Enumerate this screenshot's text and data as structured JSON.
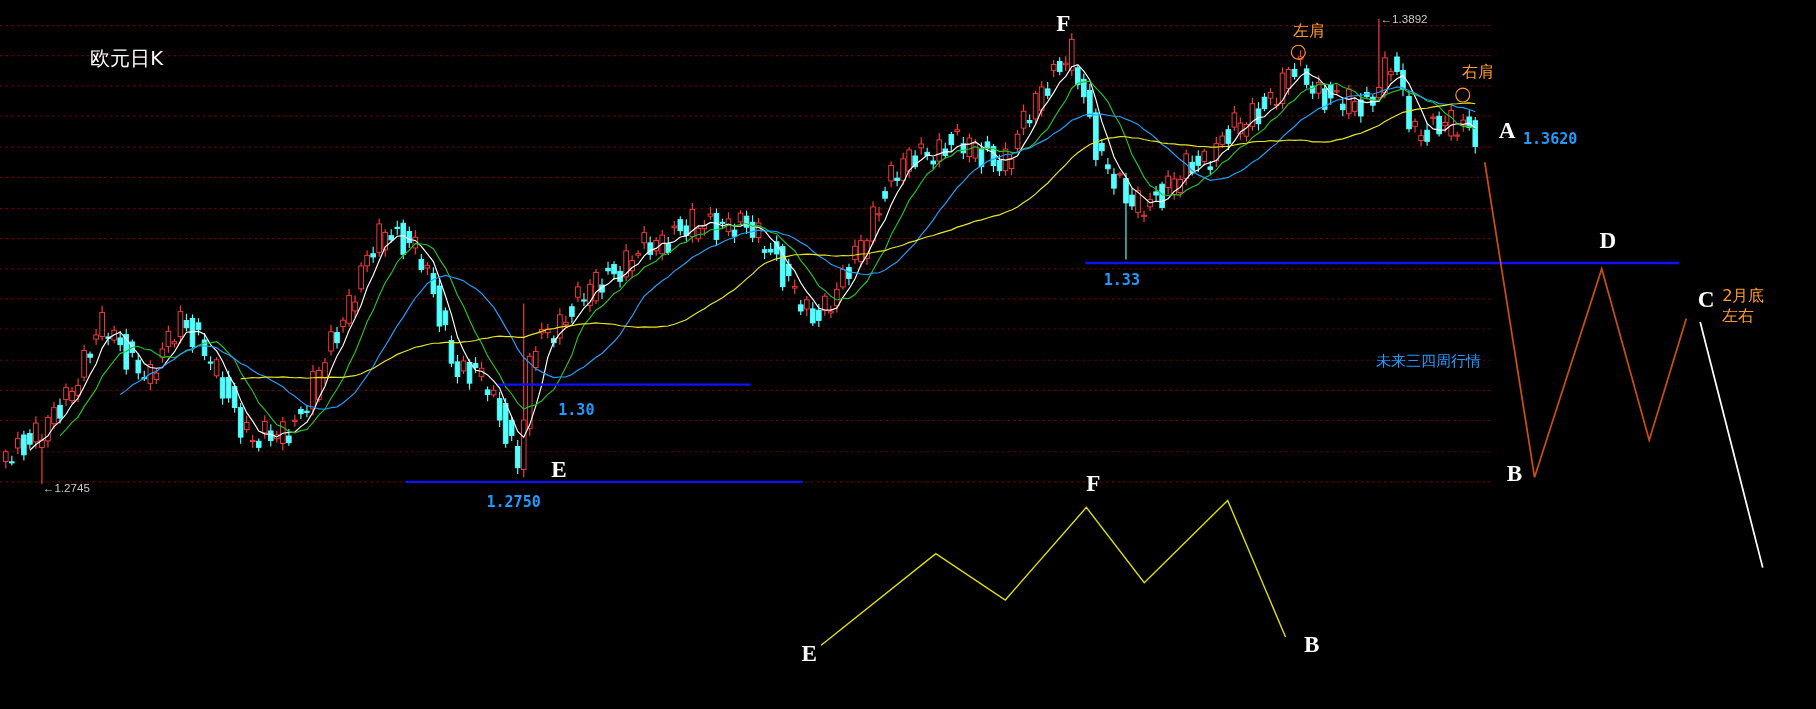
{
  "title": "欧元日K",
  "annotations": [
    {
      "kind": "point",
      "text": "F"
    },
    {
      "kind": "note",
      "text": "左肩"
    },
    {
      "kind": "extreme",
      "text": "←1.3892"
    },
    {
      "kind": "note",
      "text": "右肩"
    },
    {
      "kind": "point",
      "text": "A"
    },
    {
      "kind": "price",
      "text": "1.3620"
    },
    {
      "kind": "point",
      "text": "D"
    },
    {
      "kind": "price",
      "text": "1.33"
    },
    {
      "kind": "point",
      "text": "C"
    },
    {
      "kind": "note",
      "text": "2月底"
    },
    {
      "kind": "note",
      "text": "左右"
    },
    {
      "kind": "caption",
      "text": "未来三四周行情"
    },
    {
      "kind": "price",
      "text": "1.30"
    },
    {
      "kind": "extreme",
      "text": "←1.2745"
    },
    {
      "kind": "point",
      "text": "E"
    },
    {
      "kind": "price",
      "text": "1.2750"
    },
    {
      "kind": "point",
      "text": "B"
    },
    {
      "kind": "point",
      "text": "F"
    },
    {
      "kind": "point",
      "text": "E"
    },
    {
      "kind": "point",
      "text": "B"
    }
  ]
}
